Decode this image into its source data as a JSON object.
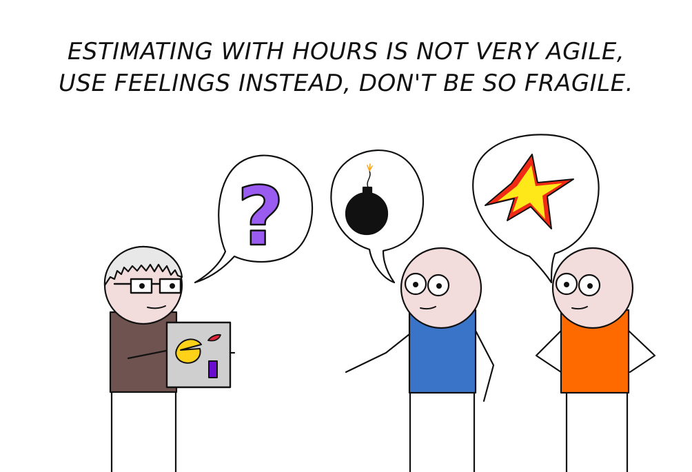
{
  "caption": {
    "line1": "ESTIMATING WITH HOURS IS NOT VERY AGILE,",
    "line2": "USE FEELINGS INSTEAD, DON'T BE SO FRAGILE."
  },
  "bubbles": {
    "manager": {
      "symbol": "?",
      "color": "#9a5cf0"
    },
    "middle": {
      "icon": "bomb-icon"
    },
    "right": {
      "icon": "explosion-star-icon"
    }
  },
  "colors": {
    "manager_shirt": "#6e5350",
    "middle_shirt": "#3a74c8",
    "right_shirt": "#ff6a00",
    "skin": "#f2dcdc",
    "hair": "#e8e8e8",
    "board": "#cfcfcf",
    "star_outer": "#f02a14",
    "star_inner": "#ffe81a"
  }
}
